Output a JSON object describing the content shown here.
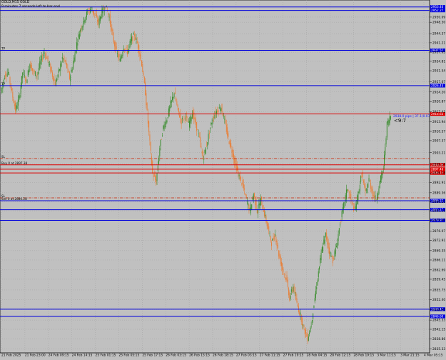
{
  "header": {
    "symbol_line": "GOLD,M15 GOLD",
    "timer_line": "9 minutes 7 seconds left to bar end"
  },
  "countdown_label": "<9:7",
  "price_readout": "2938.0 pips | 37.1(0.07",
  "colors": {
    "background": "#c0c0c0",
    "bull_candle": "#3a8d2e",
    "bear_candle": "#e8803a",
    "support_line": "#0000dd",
    "resistance_line": "#dd0000",
    "dashdot_line": "#cc2200",
    "grid": "#9a9a9a"
  },
  "price_scale": {
    "min": 2834.0,
    "max": 2956.0,
    "ticks": [
      "2950.09",
      "2948.30",
      "2944.37",
      "2941.21",
      "2937.95",
      "2934.81",
      "2931.54",
      "2927.67",
      "2924.20",
      "2920.87",
      "2917.41",
      "2913.94",
      "2910.57",
      "2907.37",
      "2903.21",
      "2899.24",
      "2896.18",
      "2892.91",
      "2889.36",
      "2886.21",
      "2883.11",
      "2879.87",
      "2876.07",
      "2872.91",
      "2869.35",
      "2866.11",
      "2862.69",
      "2859.45",
      "2855.75",
      "2852.40",
      "2848.97",
      "2845.33",
      "2842.15",
      "2838.86",
      "2835.33"
    ]
  },
  "date_axis": [
    "21 Feb 2025",
    "21 Feb 23:00",
    "24 Feb 09:15",
    "24 Feb 14:15",
    "25 Feb 01:15",
    "25 Feb 05:15",
    "25 Feb 17:15",
    "26 Feb 03:15",
    "26 Feb 15:15",
    "26 Feb 18:15",
    "27 Feb 03:15",
    "27 Feb 11:15",
    "27 Feb 19:15",
    "28 Feb 04:15",
    "28 Feb 12:15",
    "28 Feb 19:15",
    "3 Mar 11:15",
    "3 Mar 21:15",
    "4 Mar 05:15"
  ],
  "horizontal_levels": [
    {
      "price": 2953.6,
      "style": "solid",
      "color": "blue",
      "tag": "2953.46"
    },
    {
      "price": 2952.4,
      "style": "solid",
      "color": "blue",
      "tag": "2952.27"
    },
    {
      "price": 2938.6,
      "style": "solid",
      "color": "blue",
      "tag": "2937.51",
      "left_label": "TP"
    },
    {
      "price": 2926.4,
      "style": "solid",
      "color": "blue",
      "tag": "2926.45",
      "left_label": "TP"
    },
    {
      "price": 2916.6,
      "style": "solid",
      "color": "red",
      "tag": "2916.63"
    },
    {
      "price": 2901.2,
      "style": "dashdot",
      "color": "red",
      "left_label": "SL"
    },
    {
      "price": 2899.0,
      "style": "solid",
      "color": "red",
      "tag": "2899.08",
      "left_label": "Buy 0 at 2897.38"
    },
    {
      "price": 2897.5,
      "style": "solid",
      "color": "red",
      "tag": "2897.46"
    },
    {
      "price": 2896.2,
      "style": "solid",
      "color": "red",
      "tag": "2896.15"
    },
    {
      "price": 2887.6,
      "style": "dashdot",
      "color": "red",
      "left_label": "SL"
    },
    {
      "price": 2886.6,
      "style": "solid",
      "color": "blue",
      "tag": "2886.22",
      "left_label": "Sell 0 at 2886.28"
    },
    {
      "price": 2883.5,
      "style": "solid",
      "color": "blue",
      "tag": "2883.27"
    },
    {
      "price": 2879.8,
      "style": "solid",
      "color": "blue",
      "tag": "2879.87"
    },
    {
      "price": 2849.1,
      "style": "solid",
      "color": "blue",
      "tag": "2849.45"
    },
    {
      "price": 2846.6,
      "style": "solid",
      "color": "blue",
      "tag": "2846.60"
    }
  ],
  "price_path": [
    [
      0,
      2924
    ],
    [
      2,
      2930
    ],
    [
      4,
      2931
    ],
    [
      6,
      2924
    ],
    [
      8,
      2918
    ],
    [
      10,
      2922
    ],
    [
      12,
      2931
    ],
    [
      14,
      2928
    ],
    [
      16,
      2934
    ],
    [
      18,
      2931
    ],
    [
      20,
      2930
    ],
    [
      22,
      2935
    ],
    [
      24,
      2938
    ],
    [
      26,
      2935
    ],
    [
      28,
      2931
    ],
    [
      30,
      2927
    ],
    [
      32,
      2931
    ],
    [
      34,
      2936
    ],
    [
      36,
      2934
    ],
    [
      38,
      2929
    ],
    [
      40,
      2934
    ],
    [
      42,
      2941
    ],
    [
      44,
      2946
    ],
    [
      46,
      2949
    ],
    [
      48,
      2952
    ],
    [
      50,
      2953
    ],
    [
      52,
      2951
    ],
    [
      54,
      2948
    ],
    [
      56,
      2952
    ],
    [
      58,
      2954
    ],
    [
      60,
      2950
    ],
    [
      62,
      2943
    ],
    [
      64,
      2938
    ],
    [
      66,
      2935
    ],
    [
      68,
      2940
    ],
    [
      70,
      2938
    ],
    [
      72,
      2942
    ],
    [
      74,
      2944
    ],
    [
      76,
      2940
    ],
    [
      78,
      2934
    ],
    [
      80,
      2924
    ],
    [
      82,
      2910
    ],
    [
      84,
      2896
    ],
    [
      86,
      2893
    ],
    [
      88,
      2905
    ],
    [
      90,
      2912
    ],
    [
      92,
      2915
    ],
    [
      94,
      2920
    ],
    [
      96,
      2924
    ],
    [
      98,
      2918
    ],
    [
      100,
      2914
    ],
    [
      102,
      2916
    ],
    [
      104,
      2913
    ],
    [
      106,
      2917
    ],
    [
      108,
      2913
    ],
    [
      110,
      2908
    ],
    [
      112,
      2901
    ],
    [
      114,
      2906
    ],
    [
      116,
      2912
    ],
    [
      118,
      2916
    ],
    [
      120,
      2918
    ],
    [
      122,
      2919
    ],
    [
      124,
      2914
    ],
    [
      126,
      2908
    ],
    [
      128,
      2904
    ],
    [
      130,
      2899
    ],
    [
      132,
      2895
    ],
    [
      134,
      2892
    ],
    [
      136,
      2887
    ],
    [
      138,
      2883
    ],
    [
      140,
      2889
    ],
    [
      142,
      2883
    ],
    [
      144,
      2887
    ],
    [
      146,
      2882
    ],
    [
      148,
      2877
    ],
    [
      150,
      2872
    ],
    [
      152,
      2875
    ],
    [
      154,
      2868
    ],
    [
      156,
      2863
    ],
    [
      158,
      2860
    ],
    [
      160,
      2853
    ],
    [
      162,
      2857
    ],
    [
      164,
      2851
    ],
    [
      166,
      2847
    ],
    [
      168,
      2842
    ],
    [
      170,
      2839
    ],
    [
      172,
      2844
    ],
    [
      174,
      2853
    ],
    [
      176,
      2862
    ],
    [
      178,
      2870
    ],
    [
      180,
      2875
    ],
    [
      182,
      2869
    ],
    [
      184,
      2866
    ],
    [
      186,
      2871
    ],
    [
      188,
      2879
    ],
    [
      190,
      2885
    ],
    [
      192,
      2891
    ],
    [
      194,
      2887
    ],
    [
      196,
      2883
    ],
    [
      198,
      2889
    ],
    [
      200,
      2896
    ],
    [
      202,
      2889
    ],
    [
      204,
      2894
    ],
    [
      206,
      2889
    ],
    [
      208,
      2887
    ],
    [
      210,
      2893
    ],
    [
      212,
      2898
    ],
    [
      214,
      2913
    ],
    [
      216,
      2916
    ]
  ]
}
